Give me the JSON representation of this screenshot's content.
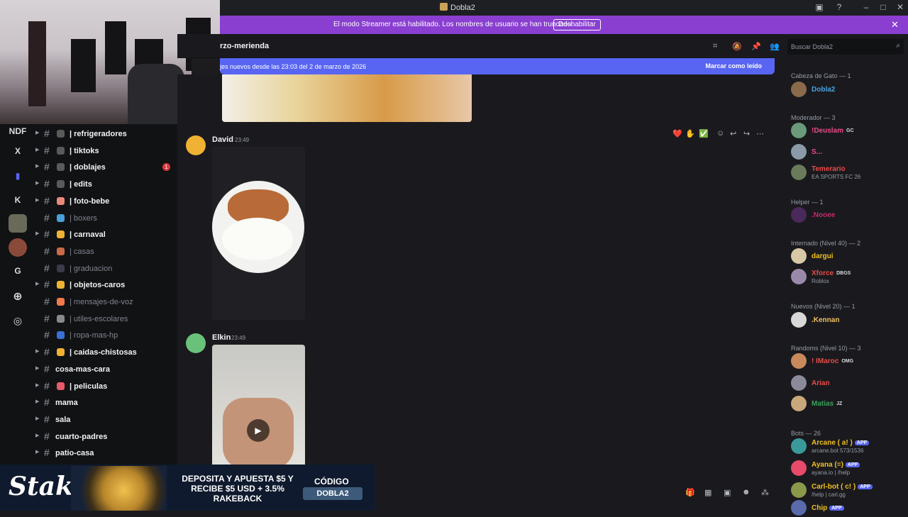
{
  "window": {
    "title": "Dobla2",
    "controls": [
      "–",
      "□",
      "✕"
    ]
  },
  "banner": {
    "message": "El modo Streamer está habilitado. Los nombres de usuario se han truncado.",
    "button": "Deshabilitar"
  },
  "rail": {
    "items": [
      "NDF",
      "X",
      "K",
      "G"
    ]
  },
  "channels": [
    {
      "name": "| refrigeradores",
      "style": "bright",
      "emoji_color": "#5a5a5a"
    },
    {
      "name": "| tiktoks",
      "style": "bright",
      "emoji_color": "#5a5a5a"
    },
    {
      "name": "| doblajes",
      "style": "bright",
      "emoji_color": "#5a5a5a",
      "badge": "1"
    },
    {
      "name": "| edits",
      "style": "bright",
      "emoji_color": "#5a5a5a"
    },
    {
      "name": "| foto-bebe",
      "style": "bright",
      "emoji_color": "#e88a7a"
    },
    {
      "name": "| boxers",
      "style": "dim",
      "emoji_color": "#4a9fd8"
    },
    {
      "name": "| carnaval",
      "style": "bright",
      "emoji_color": "#f0b232"
    },
    {
      "name": "| casas",
      "style": "dim",
      "emoji_color": "#c86a4a"
    },
    {
      "name": "| graduacion",
      "style": "dim",
      "emoji_color": "#3a3a4a"
    },
    {
      "name": "| objetos-caros",
      "style": "bright",
      "emoji_color": "#f0b232"
    },
    {
      "name": "| mensajes-de-voz",
      "style": "dim",
      "emoji_color": "#f07a4a"
    },
    {
      "name": "| utiles-escolares",
      "style": "dim",
      "emoji_color": "#8a8a8a"
    },
    {
      "name": "| ropa-mas-hp",
      "style": "dim",
      "emoji_color": "#3a6fd8"
    },
    {
      "name": "| caidas-chistosas",
      "style": "bright",
      "emoji_color": "#f0b232"
    },
    {
      "name": "cosa-mas-cara",
      "style": "bright",
      "emoji_color": ""
    },
    {
      "name": "| peliculas",
      "style": "bright",
      "emoji_color": "#e85a6a"
    },
    {
      "name": "mama",
      "style": "bright",
      "emoji_color": ""
    },
    {
      "name": "sala",
      "style": "bright",
      "emoji_color": ""
    },
    {
      "name": "cuarto-padres",
      "style": "bright",
      "emoji_color": ""
    },
    {
      "name": "patio-casa",
      "style": "bright",
      "emoji_color": ""
    }
  ],
  "header": {
    "channel": "rzo-merienda"
  },
  "newbar": {
    "text": "jes nuevos desde las 23:03 del 2 de marzo de 2026",
    "action": "Marcar como leído"
  },
  "messages": [
    {
      "author": "David",
      "time": "23:49"
    },
    {
      "author": "Elkin",
      "time": "23:49"
    }
  ],
  "search": {
    "placeholder": "Buscar Dobla2"
  },
  "members": {
    "groups": [
      {
        "label": "Cabeza de Gato — 1",
        "members": [
          {
            "name": "Dobla2",
            "color": "#4aa3df",
            "sub": "",
            "tag": "",
            "avatar": "#8a6a4a"
          }
        ]
      },
      {
        "label": "Moderador — 3",
        "members": [
          {
            "name": "!Deuslam",
            "color": "#e84a8a",
            "sub": "",
            "tag": "GC",
            "avatar": "#6a9a7a"
          },
          {
            "name": "S...",
            "color": "#e84a8a",
            "sub": "",
            "tag": "",
            "avatar": "#8a9aa8"
          },
          {
            "name": "Temerario",
            "color": "#e84a4a",
            "sub": "EA SPORTS FC 26",
            "tag": "",
            "avatar": "#6a7a5a"
          }
        ]
      },
      {
        "label": "Helper — 1",
        "members": [
          {
            "name": ".Nooee",
            "color": "#c02a6a",
            "sub": "",
            "tag": "",
            "avatar": "#4a2a5a"
          }
        ]
      },
      {
        "label": "Internado (Nivel 40) — 2",
        "members": [
          {
            "name": "dargui",
            "color": "#f0c020",
            "sub": "",
            "tag": "",
            "avatar": "#d8c8a8"
          },
          {
            "name": "Xforce",
            "color": "#e84a4a",
            "sub": "Roblox",
            "tag": "DBGS",
            "avatar": "#9a8aaa"
          }
        ]
      },
      {
        "label": "Nuevos (Nivel 20) — 1",
        "members": [
          {
            "name": ".Kennan",
            "color": "#f0c060",
            "sub": "",
            "tag": "",
            "avatar": "#d8d8d8"
          }
        ]
      },
      {
        "label": "Randoms (Nivel 10) — 3",
        "members": [
          {
            "name": "! IMaroc",
            "color": "#e84a4a",
            "sub": "",
            "tag": "OMG",
            "avatar": "#c88a5a"
          },
          {
            "name": "Arian",
            "color": "#e84a4a",
            "sub": "",
            "tag": "",
            "avatar": "#8a8a9a"
          },
          {
            "name": "Matias",
            "color": "#3aa05a",
            "sub": "",
            "tag": "JZ",
            "avatar": "#c8a87a"
          }
        ]
      },
      {
        "label": "Bots — 26",
        "members": [
          {
            "name": "Arcane ( a! )",
            "color": "#f0c020",
            "sub": "arcane.bot 573/1536",
            "tag": "APP",
            "avatar": "#3a9a9a"
          },
          {
            "name": "Ayana (=)",
            "color": "#f0c020",
            "sub": "ayana.io | /help",
            "tag": "APP",
            "avatar": "#e84a6a"
          },
          {
            "name": "Carl-bot ( c! )",
            "color": "#f0c020",
            "sub": "/help | carl.gg",
            "tag": "APP",
            "avatar": "#8a9a4a"
          },
          {
            "name": "Chip",
            "color": "#f0c020",
            "sub": "",
            "tag": "APP",
            "avatar": "#5a6aaa"
          }
        ]
      }
    ]
  },
  "ad": {
    "logo": "Stake",
    "promo": "DEPOSITA Y APUESTA $5 Y RECIBE $5 USD + 3.5% RAKEBACK",
    "code_label": "CÓDIGO",
    "code": "DOBLA2"
  }
}
